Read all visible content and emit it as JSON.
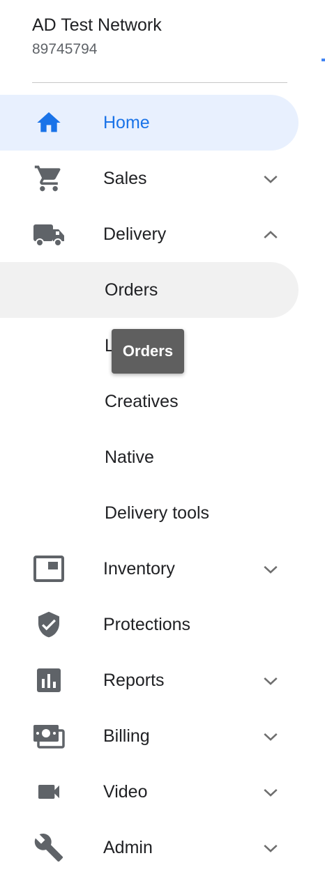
{
  "network": {
    "name": "AD Test Network",
    "id": "89745794"
  },
  "nav": {
    "home": {
      "label": "Home",
      "icon": "home-icon"
    },
    "sales": {
      "label": "Sales",
      "icon": "cart-icon"
    },
    "delivery": {
      "label": "Delivery",
      "icon": "truck-icon",
      "children": [
        "Orders",
        "Line items",
        "Creatives",
        "Native",
        "Delivery tools"
      ]
    },
    "inventory": {
      "label": "Inventory",
      "icon": "inventory-icon"
    },
    "protections": {
      "label": "Protections",
      "icon": "shield-check-icon"
    },
    "reports": {
      "label": "Reports",
      "icon": "bar-chart-icon"
    },
    "billing": {
      "label": "Billing",
      "icon": "money-icon"
    },
    "video": {
      "label": "Video",
      "icon": "video-camera-icon"
    },
    "admin": {
      "label": "Admin",
      "icon": "wrench-icon"
    }
  },
  "tooltip": {
    "text": "Orders"
  },
  "colors": {
    "accent": "#1a73e8",
    "active_bg": "#e8f0fe",
    "hover_bg": "#f1f1f1",
    "icon": "#5f6368",
    "tooltip_bg": "#5f5f5f"
  }
}
